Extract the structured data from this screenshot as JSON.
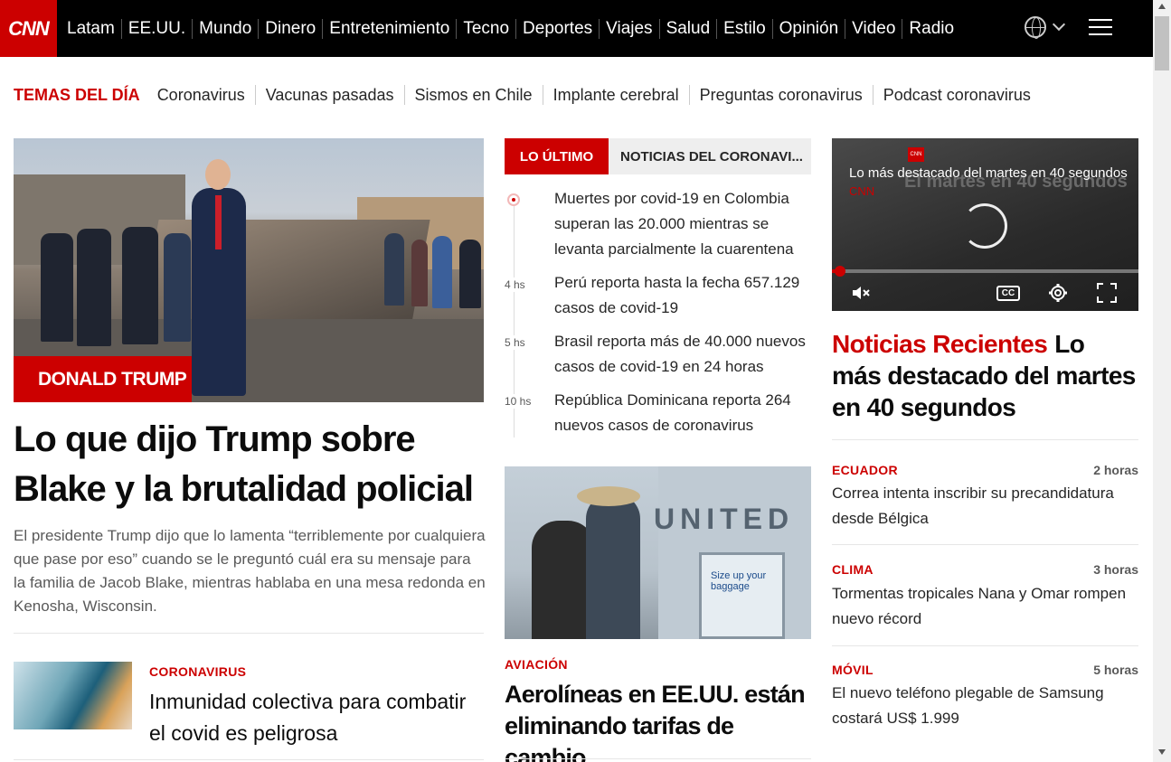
{
  "nav": {
    "logo": "CNN",
    "items": [
      "Latam",
      "EE.UU.",
      "Mundo",
      "Dinero",
      "Entretenimiento",
      "Tecno",
      "Deportes",
      "Viajes",
      "Salud",
      "Estilo",
      "Opinión",
      "Video",
      "Radio"
    ]
  },
  "temas": {
    "label": "TEMAS DEL DÍA",
    "items": [
      "Coronavirus",
      "Vacunas pasadas",
      "Sismos en Chile",
      "Implante cerebral",
      "Preguntas coronavirus",
      "Podcast coronavirus"
    ]
  },
  "hero": {
    "tag": "DONALD TRUMP",
    "headline": "Lo que dijo Trump sobre Blake y la brutalidad policial",
    "description": "El presidente Trump dijo que lo lamenta “terriblemente por cualquiera que pase por eso” cuando se le preguntó cuál era su mensaje para la familia de Jacob Blake, mientras hablaba en una mesa redonda en Kenosha, Wisconsin."
  },
  "left_story": {
    "kicker": "CORONAVIRUS",
    "title": "Inmunidad colectiva para combatir el covid es peligrosa"
  },
  "latest": {
    "tab_active": "LO ÚLTIMO",
    "tab_other": "NOTICIAS DEL CORONAVI...",
    "items": [
      {
        "time": "",
        "text": "Muertes por covid-19 en Colombia superan las 20.000 mientras se levanta parcialmente la cuarentena"
      },
      {
        "time": "4 hs",
        "text": "Perú reporta hasta la fecha 657.129 casos de covid-19"
      },
      {
        "time": "5 hs",
        "text": "Brasil reporta más de 40.000 nuevos casos de covid-19 en 24 horas"
      },
      {
        "time": "10 hs",
        "text": "República Dominicana reporta 264 nuevos casos de coronavirus"
      }
    ]
  },
  "mid_story": {
    "photo_text": "UNITED",
    "kiosk_text": "Size up your baggage",
    "kicker": "AVIACIÓN",
    "title": "Aerolíneas en EE.UU. están eliminando tarifas de cambio"
  },
  "video": {
    "title": "Lo más destacado del martes en 40 segundos",
    "source": "CNN",
    "ghost_text": "El martes en 40 segundos",
    "cc_label": "CC",
    "progress": 0.02
  },
  "recent": {
    "label": "Noticias Recientes",
    "headline": "Lo más destacado del martes en 40 segundos",
    "items": [
      {
        "kicker": "ECUADOR",
        "time": "2 horas",
        "text": "Correa intenta inscribir su precandidatura desde Bélgica"
      },
      {
        "kicker": "CLIMA",
        "time": "3 horas",
        "text": "Tormentas tropicales Nana y Omar rompen nuevo récord"
      },
      {
        "kicker": "MÓVIL",
        "time": "5 horas",
        "text": "El nuevo teléfono plegable de Samsung costará US$ 1.999"
      }
    ]
  },
  "colors": {
    "brand_red": "#cc0000",
    "nav_bg": "#000000"
  }
}
